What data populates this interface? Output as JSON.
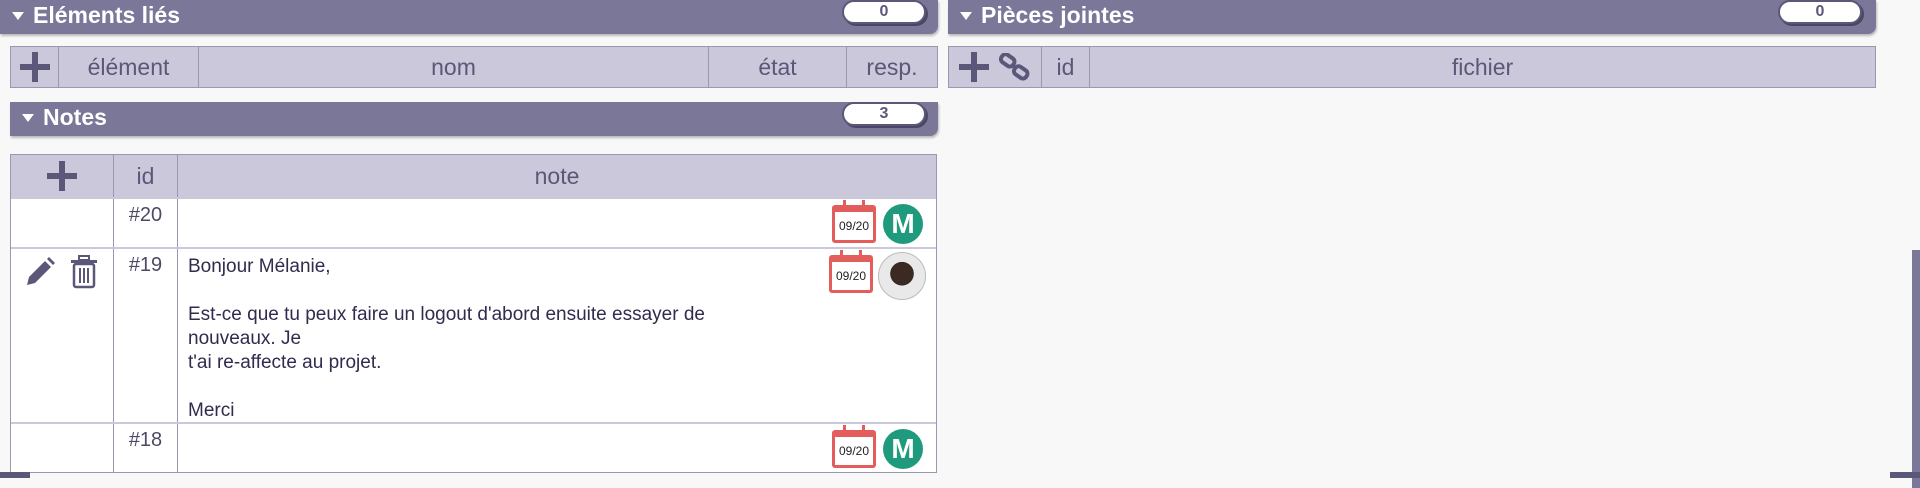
{
  "linked": {
    "title": "Eléments liés",
    "count": "0",
    "headers": [
      "élément",
      "nom",
      "état",
      "resp."
    ]
  },
  "attachments": {
    "title": "Pièces jointes",
    "count": "0",
    "headers": [
      "id",
      "fichier"
    ]
  },
  "notes": {
    "title": "Notes",
    "count": "3",
    "headers": [
      "id",
      "note"
    ],
    "rows": [
      {
        "id": "#20",
        "text": "",
        "date": "09/20",
        "avatar_letter": "M"
      },
      {
        "id": "#19",
        "text": "Bonjour Mélanie,\n\nEst-ce que tu peux faire un logout d'abord ensuite essayer de\nnouveaux. Je\nt'ai re-affecte au projet.\n\nMerci",
        "date": "09/20"
      },
      {
        "id": "#18",
        "text": "",
        "date": "09/20",
        "avatar_letter": "M"
      }
    ]
  },
  "colors": {
    "header_bar": "#7b7799",
    "table_header": "#cbc8dc",
    "accent": "#5b5778",
    "avatar": "#1f9a7c",
    "calendar": "#e35d5d"
  }
}
